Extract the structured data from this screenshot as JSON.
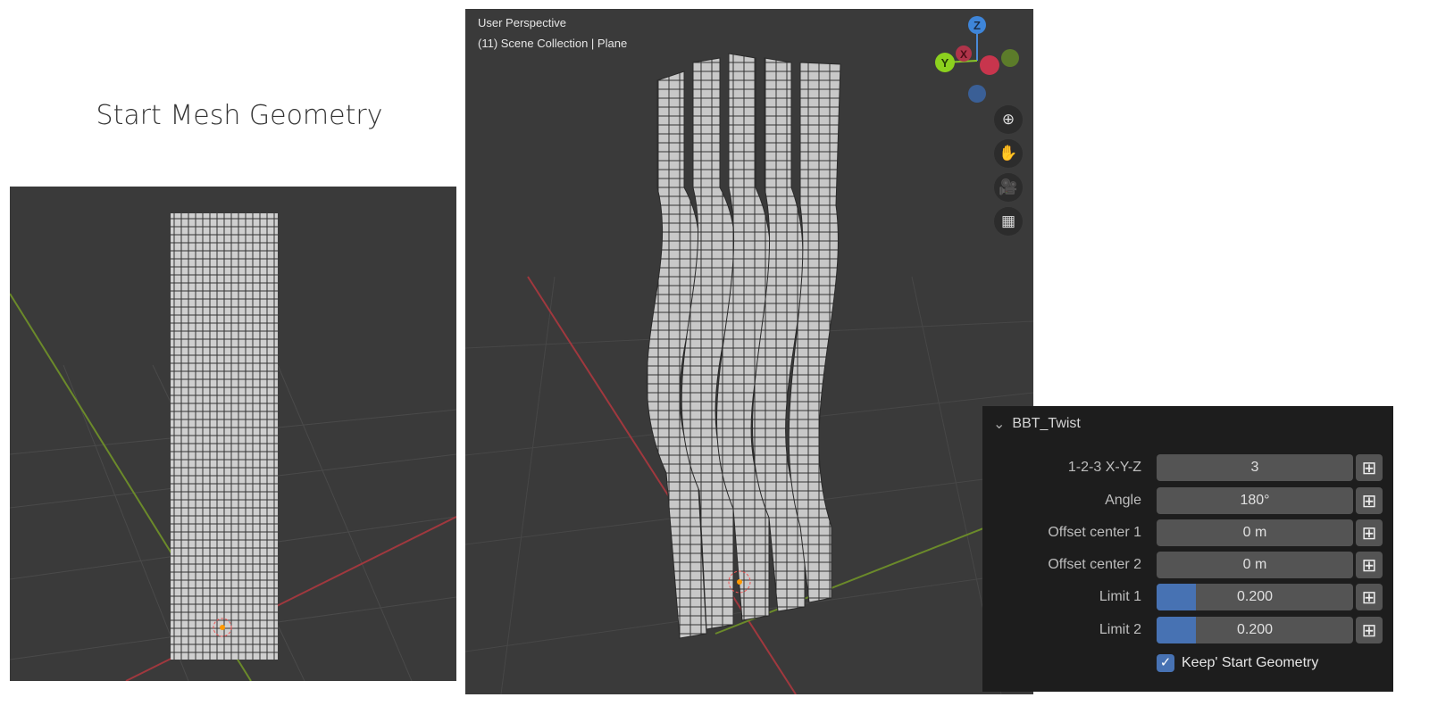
{
  "title": "Start Mesh Geometry",
  "viewport": {
    "view_name": "User Perspective",
    "collection": "(11) Scene Collection | Plane"
  },
  "gizmo": {
    "z": "Z",
    "y": "Y",
    "x": "X"
  },
  "nav_icons": [
    "zoom-icon",
    "hand-pan-icon",
    "camera-icon",
    "grid-ortho-icon"
  ],
  "panel": {
    "title": "BBT_Twist",
    "rows": [
      {
        "label": "1-2-3 X-Y-Z",
        "value": "3"
      },
      {
        "label": "Angle",
        "value": "180°"
      },
      {
        "label": "Offset center 1",
        "value": "0 m"
      },
      {
        "label": "Offset center 2",
        "value": "0 m"
      },
      {
        "label": "Limit 1",
        "value": "0.200",
        "fraction": 0.2
      },
      {
        "label": "Limit 2",
        "value": "0.200",
        "fraction": 0.2
      }
    ],
    "checkbox": {
      "label": "Keep' Start Geometry",
      "checked": true
    }
  },
  "colors": {
    "accent": "#4772b3",
    "viewport_bg": "#3a3a3a",
    "panel_bg": "#1d1d1d"
  }
}
